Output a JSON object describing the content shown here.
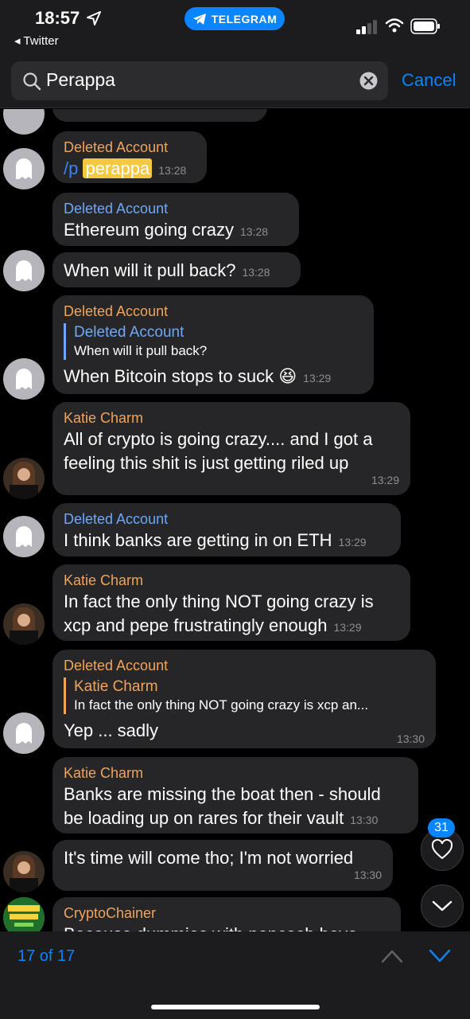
{
  "status": {
    "time": "18:57",
    "back_app": "◂ Twitter",
    "pill_label": "TELEGRAM"
  },
  "search": {
    "query": "Perappa",
    "cancel_label": "Cancel"
  },
  "messages": [
    {
      "sender": "Deleted Account",
      "cmd": "/p",
      "highlight": "perappa",
      "time": "13:28"
    },
    {
      "sender": "Deleted Account",
      "text": "Ethereum going crazy",
      "time": "13:28"
    },
    {
      "text": "When will it pull back?",
      "time": "13:28"
    },
    {
      "sender": "Deleted Account",
      "reply_name": "Deleted Account",
      "reply_text": "When will it pull back?",
      "text": "When Bitcoin stops to suck 😆",
      "time": "13:29"
    },
    {
      "sender": "Katie Charm",
      "text_line1": "All of crypto is going crazy.... and I got a",
      "text_line2": "feeling this shit is just getting riled up",
      "time": "13:29"
    },
    {
      "sender": "Deleted Account",
      "text": "I think banks are getting in on ETH",
      "time": "13:29"
    },
    {
      "sender": "Katie Charm",
      "text_line1": "In fact the only thing NOT going crazy is",
      "text_line2": "xcp and pepe frustratingly enough",
      "time": "13:29"
    },
    {
      "sender": "Deleted Account",
      "reply_name": "Katie Charm",
      "reply_text": "In fact the only thing NOT going crazy is xcp an...",
      "text": "Yep ... sadly",
      "time": "13:30"
    },
    {
      "sender": "Katie Charm",
      "text_line1": "Banks are missing the boat then - should",
      "text_line2": "be loading up on rares for their vault",
      "time": "13:30"
    },
    {
      "text": "It's time will come tho; I'm not worried",
      "time": "13:30"
    },
    {
      "sender": "CryptoChainer",
      "text": "Because dummies with popcash have"
    }
  ],
  "badge": "31",
  "bottom": {
    "counter": "17 of 17"
  },
  "colors": {
    "accent": "#0a84ff",
    "sender_orange": "#f0a45b",
    "sender_blue": "#6ea8f7",
    "highlight": "#f5c842",
    "bubble": "#262628"
  }
}
